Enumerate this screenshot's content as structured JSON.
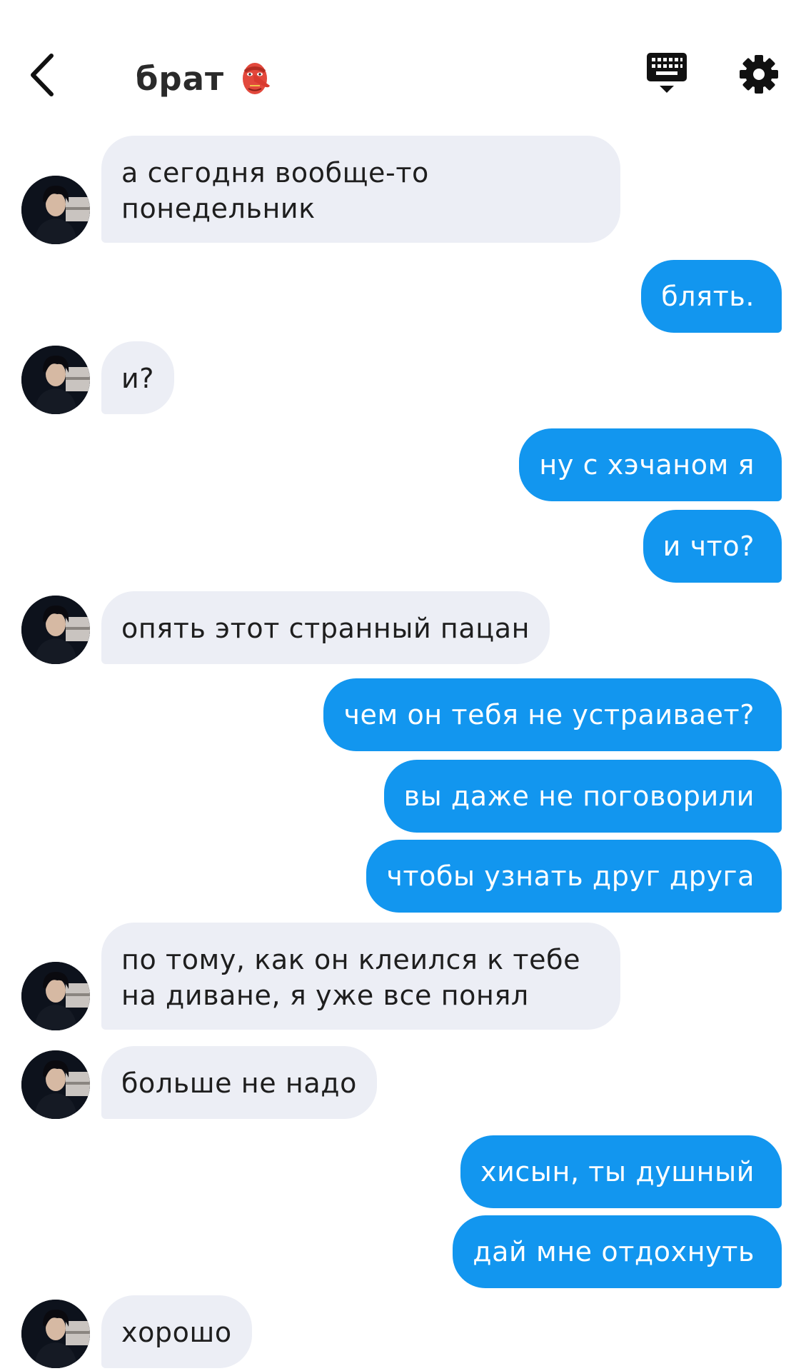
{
  "header": {
    "title": "брат",
    "title_icon": "goblin-mask-icon",
    "back_icon": "chevron-left-icon",
    "keyboard_icon": "keyboard-icon",
    "settings_icon": "gear-icon"
  },
  "colors": {
    "outgoing_bubble": "#1296ef",
    "incoming_bubble": "#eceef5",
    "title_text": "#2a2a2a"
  },
  "messages": [
    {
      "direction": "in",
      "text": "а сегодня вообще-то\nпонедельник"
    },
    {
      "direction": "out",
      "text": "блять."
    },
    {
      "direction": "in",
      "text": "и?"
    },
    {
      "direction": "out",
      "text": "ну с хэчаном я"
    },
    {
      "direction": "out",
      "text": "и что?"
    },
    {
      "direction": "in",
      "text": "опять этот странный пацан"
    },
    {
      "direction": "out",
      "text": "чем он тебя не устраивает?"
    },
    {
      "direction": "out",
      "text": "вы даже не поговорили"
    },
    {
      "direction": "out",
      "text": "чтобы узнать друг друга"
    },
    {
      "direction": "in",
      "text": "по тому, как он клеился к тебе\nна диване, я уже все понял"
    },
    {
      "direction": "in",
      "text": "больше не надо"
    },
    {
      "direction": "out",
      "text": "хисын, ты душный"
    },
    {
      "direction": "out",
      "text": "дай мне отдохнуть"
    },
    {
      "direction": "in",
      "text": "хорошо"
    }
  ]
}
